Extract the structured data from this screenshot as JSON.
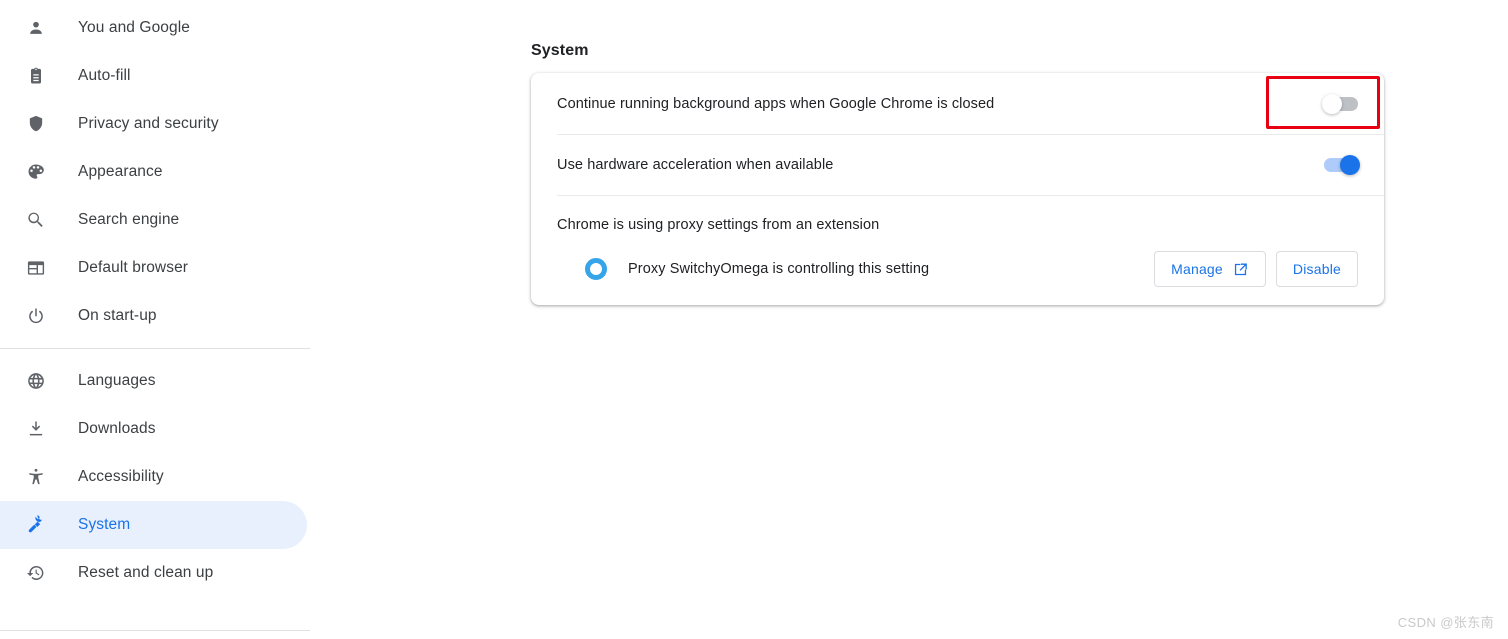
{
  "sidebar": {
    "groups": [
      {
        "items": [
          {
            "label": "You and Google",
            "icon": "person-icon",
            "selected": false
          },
          {
            "label": "Auto-fill",
            "icon": "clipboard-icon",
            "selected": false
          },
          {
            "label": "Privacy and security",
            "icon": "shield-icon",
            "selected": false
          },
          {
            "label": "Appearance",
            "icon": "palette-icon",
            "selected": false
          },
          {
            "label": "Search engine",
            "icon": "search-icon",
            "selected": false
          },
          {
            "label": "Default browser",
            "icon": "browser-window-icon",
            "selected": false
          },
          {
            "label": "On start-up",
            "icon": "power-icon",
            "selected": false
          }
        ]
      },
      {
        "items": [
          {
            "label": "Languages",
            "icon": "globe-icon",
            "selected": false
          },
          {
            "label": "Downloads",
            "icon": "download-icon",
            "selected": false
          },
          {
            "label": "Accessibility",
            "icon": "accessibility-icon",
            "selected": false
          },
          {
            "label": "System",
            "icon": "wrench-icon",
            "selected": true
          },
          {
            "label": "Reset and clean up",
            "icon": "history-restore-icon",
            "selected": false
          }
        ]
      }
    ]
  },
  "main": {
    "section_title": "System",
    "settings": [
      {
        "label": "Continue running background apps when Google Chrome is closed",
        "control": "toggle",
        "state": "off",
        "highlighted": true
      },
      {
        "label": "Use hardware acceleration when available",
        "control": "toggle",
        "state": "on",
        "highlighted": false
      }
    ],
    "proxy": {
      "heading": "Chrome is using proxy settings from an extension",
      "extension_icon": "switchyomega-ring-icon",
      "extension_text": "Proxy SwitchyOmega is controlling this setting",
      "buttons": [
        {
          "label": "Manage",
          "icon": "external-link-icon"
        },
        {
          "label": "Disable",
          "icon": null
        }
      ]
    }
  },
  "watermark": "CSDN @张东南",
  "colors": {
    "accent_blue": "#1a73e8",
    "selected_pill": "#e8f0fe",
    "toggle_on_track": "#aecbfa",
    "toggle_off_track": "#bdc1c6",
    "highlight_red": "#e60012",
    "extension_icon_blue": "#35a4e8",
    "text_primary": "#202124",
    "text_secondary": "#5f6368"
  }
}
